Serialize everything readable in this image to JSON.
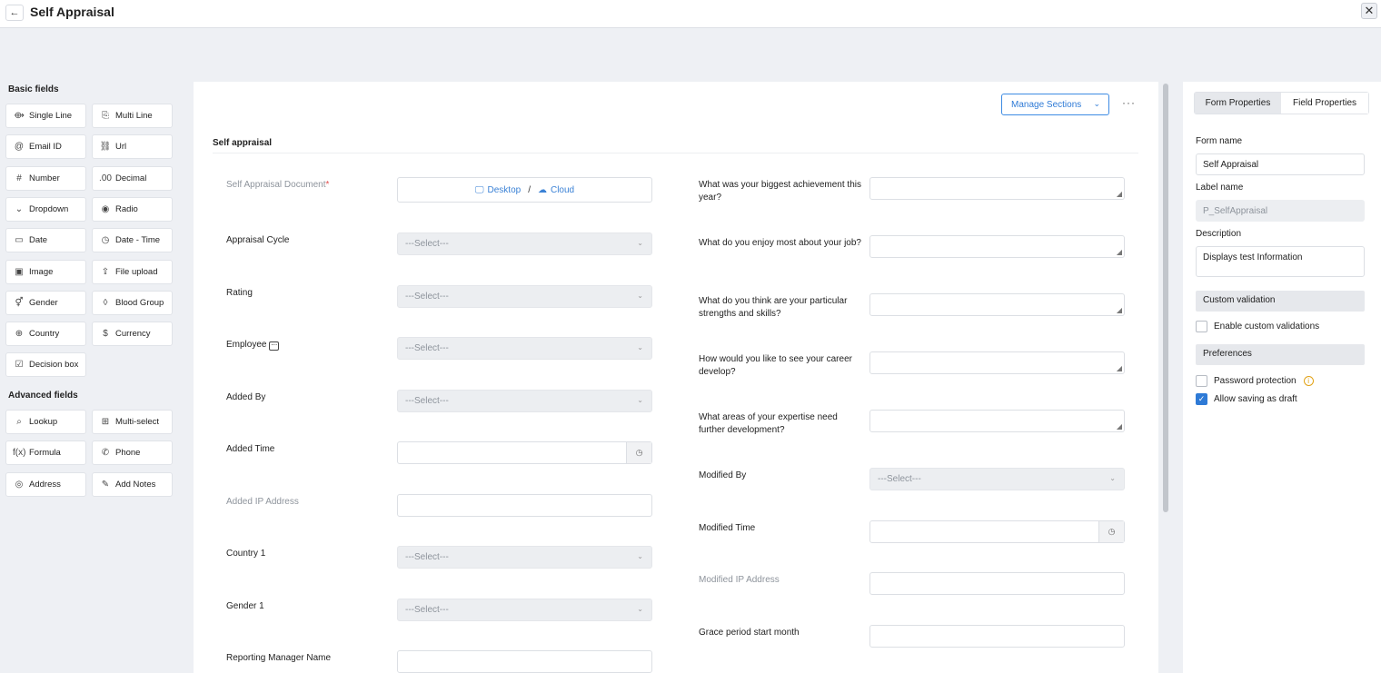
{
  "header": {
    "back_icon": "←",
    "title": "Self Appraisal",
    "close_icon": "✕"
  },
  "left_panel": {
    "basic_title": "Basic fields",
    "basic": [
      {
        "icon": "⟴",
        "label": "Single Line"
      },
      {
        "icon": "⎘",
        "label": "Multi Line"
      },
      {
        "icon": "@",
        "label": "Email ID"
      },
      {
        "icon": "⛓",
        "label": "Url"
      },
      {
        "icon": "#",
        "label": "Number"
      },
      {
        "icon": ".00",
        "label": "Decimal"
      },
      {
        "icon": "⌄",
        "label": "Dropdown"
      },
      {
        "icon": "◉",
        "label": "Radio"
      },
      {
        "icon": "▭",
        "label": "Date"
      },
      {
        "icon": "◷",
        "label": "Date - Time"
      },
      {
        "icon": "▣",
        "label": "Image"
      },
      {
        "icon": "⇪",
        "label": "File upload"
      },
      {
        "icon": "⚥",
        "label": "Gender"
      },
      {
        "icon": "◊",
        "label": "Blood Group"
      },
      {
        "icon": "⊕",
        "label": "Country"
      },
      {
        "icon": "$",
        "label": "Currency"
      },
      {
        "icon": "☑",
        "label": "Decision box"
      }
    ],
    "advanced_title": "Advanced fields",
    "advanced": [
      {
        "icon": "⌕",
        "label": "Lookup"
      },
      {
        "icon": "⊞",
        "label": "Multi-select"
      },
      {
        "icon": "f(x)",
        "label": "Formula"
      },
      {
        "icon": "✆",
        "label": "Phone"
      },
      {
        "icon": "◎",
        "label": "Address"
      },
      {
        "icon": "✎",
        "label": "Add Notes"
      }
    ]
  },
  "canvas": {
    "manage_sections": "Manage Sections",
    "more": "···",
    "section_title": "Self appraisal",
    "doc_label": "Self Appraisal Document",
    "required_mark": "*",
    "desktop": "Desktop",
    "upload_sep": "/",
    "cloud": "Cloud",
    "select_placeholder": "---Select---",
    "left_fields": {
      "appraisal_cycle": "Appraisal Cycle",
      "rating": "Rating",
      "employee": "Employee",
      "added_by": "Added By",
      "added_time": "Added Time",
      "added_ip": "Added IP Address",
      "country1": "Country 1",
      "gender1": "Gender 1",
      "reporting_manager": "Reporting Manager Name"
    },
    "right_fields": {
      "q1": "What was your biggest achievement this year?",
      "q2": "What do you enjoy most about your job?",
      "q3": "What do you think are your particular strengths and skills?",
      "q4": "How would you like to see your career develop?",
      "q5": "What areas of your expertise need further development?",
      "modified_by": "Modified By",
      "modified_time": "Modified Time",
      "modified_ip": "Modified IP Address",
      "grace_period": "Grace period start month"
    }
  },
  "right_panel": {
    "tab_form": "Form Properties",
    "tab_field": "Field Properties",
    "form_name_label": "Form name",
    "form_name_value": "Self Appraisal",
    "label_name_label": "Label name",
    "label_name_value": "P_SelfAppraisal",
    "description_label": "Description",
    "description_value": "Displays test Information",
    "custom_validation": "Custom validation",
    "enable_custom": "Enable custom validations",
    "preferences": "Preferences",
    "password_protection": "Password protection",
    "allow_draft": "Allow saving as draft",
    "allow_draft_checked": true,
    "password_checked": false,
    "enable_custom_checked": false
  }
}
